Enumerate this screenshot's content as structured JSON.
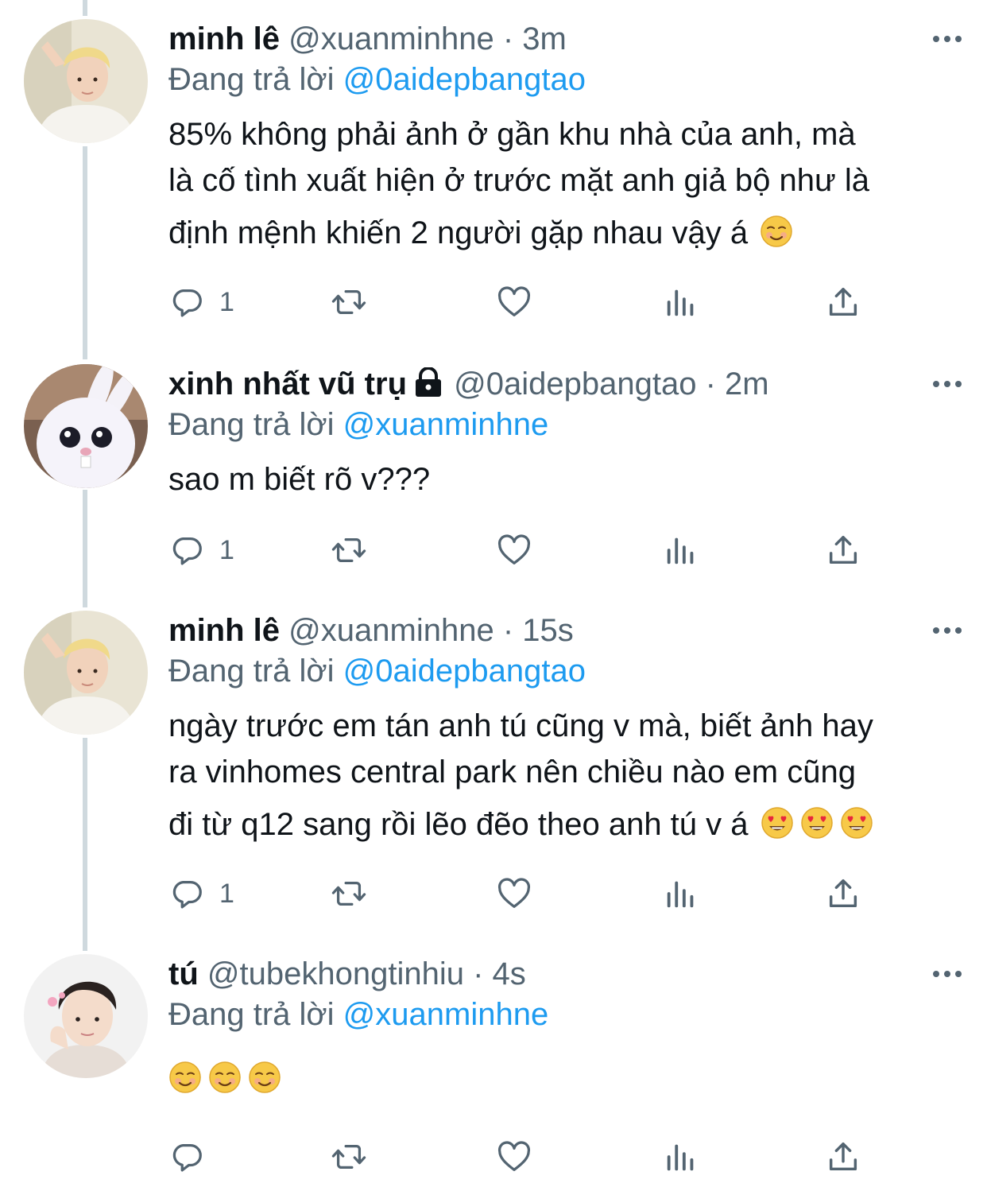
{
  "colors": {
    "text": "#0f1419",
    "secondary": "#536471",
    "link": "#1d9bf0",
    "thread": "#cfd9de"
  },
  "tweets": [
    {
      "name": "minh lê",
      "handle": "@xuanminhne",
      "separator": "·",
      "time": "3m",
      "replying_prefix": "Đang trả lời",
      "replying_to": "@0aidepbangtao",
      "text_line1": "85% không phải ảnh ở gần khu nhà của anh, mà",
      "text_line2": "là cố tình xuất hiện ở trước mặt anh giả bộ như là",
      "text_line3": "định mệnh khiến 2 người gặp nhau vậy á",
      "emoji": [
        "smiling-face"
      ],
      "reply_count": "1",
      "avatar": "blond-boy-avatar"
    },
    {
      "name": "xinh nhất vũ trụ",
      "handle": "@0aidepbangtao",
      "separator": "·",
      "time": "2m",
      "replying_prefix": "Đang trả lời",
      "replying_to": "@xuanminhne",
      "text_line1": "sao m biết rõ v???",
      "reply_count": "1",
      "protected": true,
      "avatar": "white-bunny-avatar"
    },
    {
      "name": "minh lê",
      "handle": "@xuanminhne",
      "separator": "·",
      "time": "15s",
      "replying_prefix": "Đang trả lời",
      "replying_to": "@0aidepbangtao",
      "text_line1": "ngày trước em tán anh tú cũng v mà, biết ảnh hay",
      "text_line2": "ra vinhomes central park nên chiều nào em cũng",
      "text_line3": "đi từ q12 sang rồi lẽo đẽo theo anh tú v á",
      "emoji": [
        "heart-eyes",
        "heart-eyes",
        "heart-eyes"
      ],
      "reply_count": "1",
      "avatar": "blond-boy-avatar"
    },
    {
      "name": "tú",
      "handle": "@tubekhongtinhiu",
      "separator": "·",
      "time": "4s",
      "replying_prefix": "Đang trả lời",
      "replying_to": "@xuanminhne",
      "emoji": [
        "smiling-face",
        "smiling-face",
        "smiling-face"
      ],
      "reply_count": "",
      "avatar": "dark-hair-boy-avatar"
    }
  ],
  "icons": {
    "reply": "reply-icon",
    "retweet": "retweet-icon",
    "like": "heart-icon",
    "stats": "stats-icon",
    "share": "share-icon",
    "more": "more-icon",
    "lock": "lock-icon"
  }
}
